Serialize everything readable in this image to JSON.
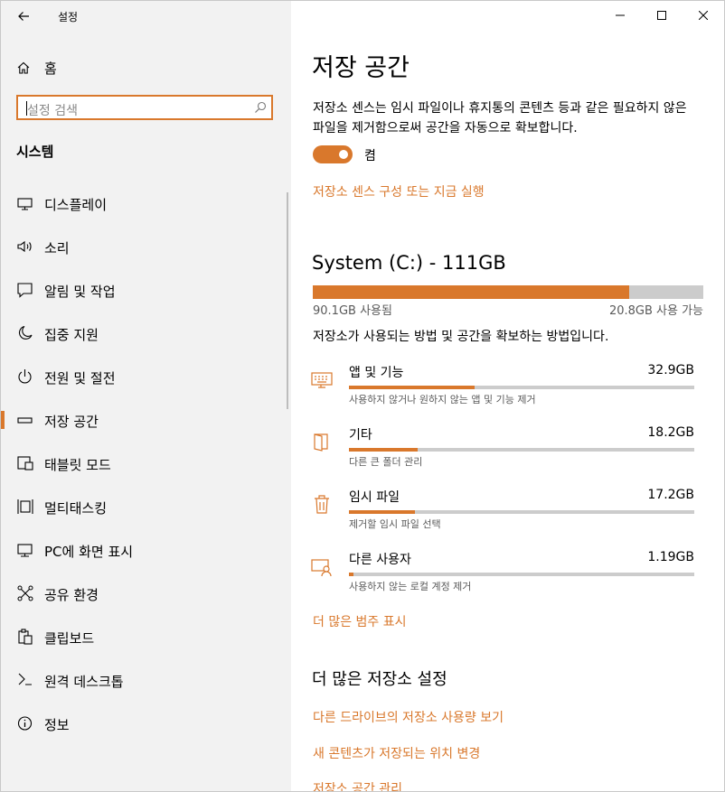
{
  "window": {
    "title": "설정"
  },
  "sidebar": {
    "home_label": "홈",
    "search": {
      "placeholder": "설정 검색"
    },
    "section_title": "시스템",
    "items": [
      {
        "label": "디스플레이",
        "icon": "monitor-icon"
      },
      {
        "label": "소리",
        "icon": "speaker-icon"
      },
      {
        "label": "알림 및 작업",
        "icon": "notification-icon"
      },
      {
        "label": "집중 지원",
        "icon": "moon-icon"
      },
      {
        "label": "전원 및 절전",
        "icon": "power-icon"
      },
      {
        "label": "저장 공간",
        "icon": "storage-icon",
        "selected": true
      },
      {
        "label": "태블릿 모드",
        "icon": "tablet-icon"
      },
      {
        "label": "멀티태스킹",
        "icon": "multitasking-icon"
      },
      {
        "label": "PC에 화면 표시",
        "icon": "project-icon"
      },
      {
        "label": "공유 환경",
        "icon": "share-icon"
      },
      {
        "label": "클립보드",
        "icon": "clipboard-icon"
      },
      {
        "label": "원격 데스크톱",
        "icon": "remote-desktop-icon"
      },
      {
        "label": "정보",
        "icon": "info-icon"
      }
    ]
  },
  "main": {
    "title": "저장 공간",
    "description": "저장소 센스는 임시 파일이나 휴지통의 콘텐츠 등과 같은 필요하지 않은 파일을 제거함으로써 공간을 자동으로 확보합니다.",
    "toggle": {
      "state": "on",
      "label": "켬"
    },
    "configure_link": "저장소 센스 구성 또는 지금 실행",
    "drive": {
      "title": "System (C:) - 111GB",
      "used_label": "90.1GB 사용됨",
      "free_label": "20.8GB 사용 가능",
      "used_fraction": 0.81
    },
    "howto_text": "저장소가 사용되는 방법 및 공간을 확보하는 방법입니다.",
    "categories": [
      {
        "name": "앱 및 기능",
        "size": "32.9GB",
        "sub": "사용하지 않거나 원하지 않는 앱 및 기능 제거",
        "fraction": 0.365,
        "icon": "keyboard-icon"
      },
      {
        "name": "기타",
        "size": "18.2GB",
        "sub": "다른 큰 폴더 관리",
        "fraction": 0.2,
        "icon": "folder-icon"
      },
      {
        "name": "임시 파일",
        "size": "17.2GB",
        "sub": "제거할 임시 파일 선택",
        "fraction": 0.19,
        "icon": "trash-icon"
      },
      {
        "name": "다른 사용자",
        "size": "1.19GB",
        "sub": "사용하지 않는 로컬 계정 제거",
        "fraction": 0.013,
        "icon": "user-icon"
      }
    ],
    "more_categories_link": "더 많은 범주 표시",
    "more_settings_title": "더 많은 저장소 설정",
    "links": [
      "다른 드라이브의 저장소 사용량 보기",
      "새 콘텐츠가 저장되는 위치 변경",
      "저장소 공간 관리"
    ]
  },
  "colors": {
    "accent": "#d9782c",
    "sidebar_bg": "#f2f2f2",
    "bar_bg": "#cccccc"
  }
}
